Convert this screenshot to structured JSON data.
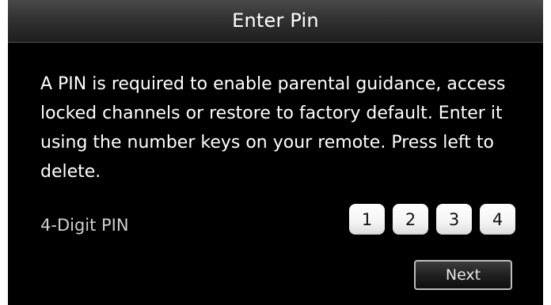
{
  "dialog": {
    "title": "Enter Pin",
    "message": "A PIN is required to enable parental guidance, access locked channels or restore to factory default. Enter it using the number keys on your remote. Press left to delete.",
    "pin_label": "4-Digit PIN",
    "pin_digits": [
      "1",
      "2",
      "3",
      "4"
    ],
    "next_label": "Next"
  },
  "colors": {
    "background": "#000000",
    "header": "#323232",
    "text": "#ffffff",
    "pin_box": "#f4f4f4"
  }
}
